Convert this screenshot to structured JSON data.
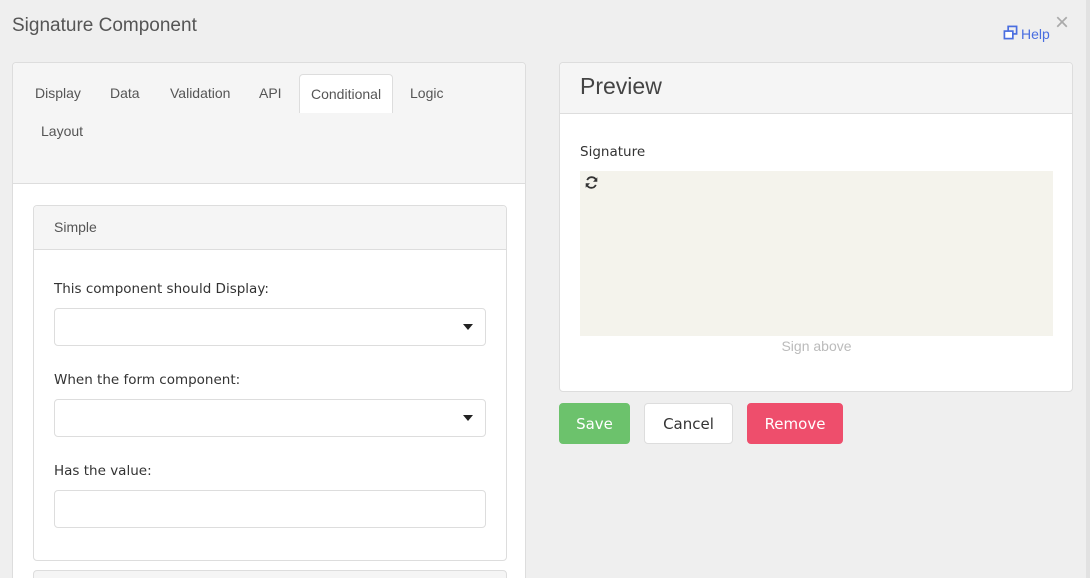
{
  "modal": {
    "title": "Signature Component",
    "help_label": "Help"
  },
  "tabs": [
    {
      "label": "Display"
    },
    {
      "label": "Data"
    },
    {
      "label": "Validation"
    },
    {
      "label": "API"
    },
    {
      "label": "Conditional",
      "active": true
    },
    {
      "label": "Logic"
    },
    {
      "label": "Layout"
    }
  ],
  "conditional": {
    "card_title": "Simple",
    "display_label": "This component should Display:",
    "display_value": "",
    "component_label": "When the form component:",
    "component_value": "",
    "value_label": "Has the value:",
    "value_value": ""
  },
  "preview": {
    "title": "Preview",
    "field_label": "Signature",
    "hint": "Sign above"
  },
  "actions": {
    "save": "Save",
    "cancel": "Cancel",
    "remove": "Remove"
  },
  "colors": {
    "save": "#6cc26c",
    "remove": "#ee4e6c",
    "link": "#4a6ee0",
    "signature_pad": "#f4f3ec"
  },
  "icons": {
    "help": "external-window-icon",
    "close": "close-icon",
    "refresh": "refresh-icon",
    "caret": "caret-down-icon"
  }
}
